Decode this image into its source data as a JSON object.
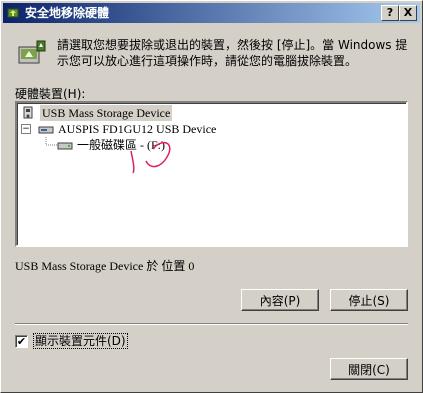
{
  "window": {
    "title": "安全地移除硬體",
    "help_button": "?",
    "close_button": "X"
  },
  "header": {
    "description": "請選取您想要拔除或退出的裝置，然後按 [停止]。當 Windows 提示您可以放心進行這項操作時，請從您的電腦拔除裝置。"
  },
  "devices": {
    "label": "硬體裝置(H):",
    "tree": [
      {
        "label": "USB Mass Storage Device",
        "icon": "usb-device-icon",
        "selected": true
      },
      {
        "label": "AUSPIS FD1GU12 USB Device",
        "icon": "drive-icon",
        "expander": "−"
      },
      {
        "label": "一般磁碟區 - (F:)",
        "icon": "volume-icon"
      }
    ]
  },
  "status_text": "USB Mass Storage Device 於 位置 0",
  "buttons": {
    "properties": "內容(P)",
    "stop": "停止(S)",
    "close": "關閉(C)"
  },
  "show_components": {
    "label": "顯示裝置元件(D)",
    "checked": "✔"
  }
}
